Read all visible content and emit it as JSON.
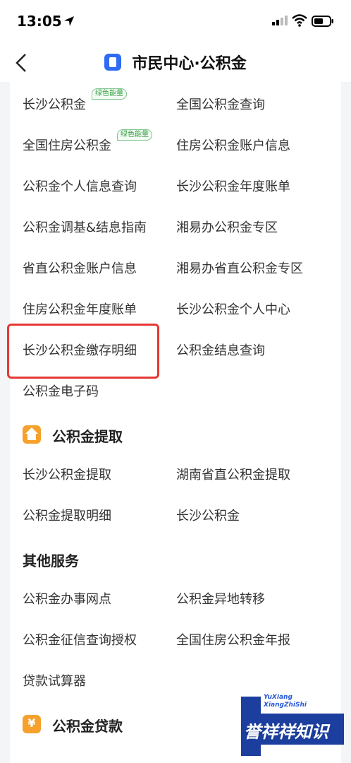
{
  "status_bar": {
    "time": "13:05"
  },
  "nav": {
    "title": "市民中心·公积金"
  },
  "badges": {
    "green_energy": "绿色能量"
  },
  "rows": [
    {
      "left": "长沙公积金",
      "right": "全国公积金查询"
    },
    {
      "left": "全国住房公积金",
      "right": "住房公积金账户信息"
    },
    {
      "left": "公积金个人信息查询",
      "right": "长沙公积金年度账单"
    },
    {
      "left": "公积金调基&结息指南",
      "right": "湘易办公积金专区"
    },
    {
      "left": "省直公积金账户信息",
      "right": "湘易办省直公积金专区"
    },
    {
      "left": "住房公积金年度账单",
      "right": "长沙公积金个人中心"
    },
    {
      "left": "长沙公积金缴存明细",
      "right": "公积金结息查询"
    },
    {
      "left": "公积金电子码",
      "right": ""
    }
  ],
  "sections": {
    "withdraw": {
      "title": "公积金提取",
      "rows": [
        {
          "left": "长沙公积金提取",
          "right": "湖南省直公积金提取"
        },
        {
          "left": "公积金提取明细",
          "right": "长沙公积金"
        }
      ]
    },
    "other": {
      "title": "其他服务",
      "rows": [
        {
          "left": "公积金办事网点",
          "right": "公积金异地转移"
        },
        {
          "left": "公积金征信查询授权",
          "right": "全国住房公积金年报"
        },
        {
          "left": "贷款试算器",
          "right": ""
        }
      ]
    },
    "loan": {
      "title": "公积金贷款"
    }
  },
  "watermark": {
    "small_line1": "YuXiang",
    "small_line2": "XiangZhiShi",
    "text": "誉祥祥知识"
  },
  "colors": {
    "accent": "#2f6bf4",
    "highlight": "#e53935",
    "badge": "#3aa146",
    "section_icon": "#f5a12c"
  }
}
